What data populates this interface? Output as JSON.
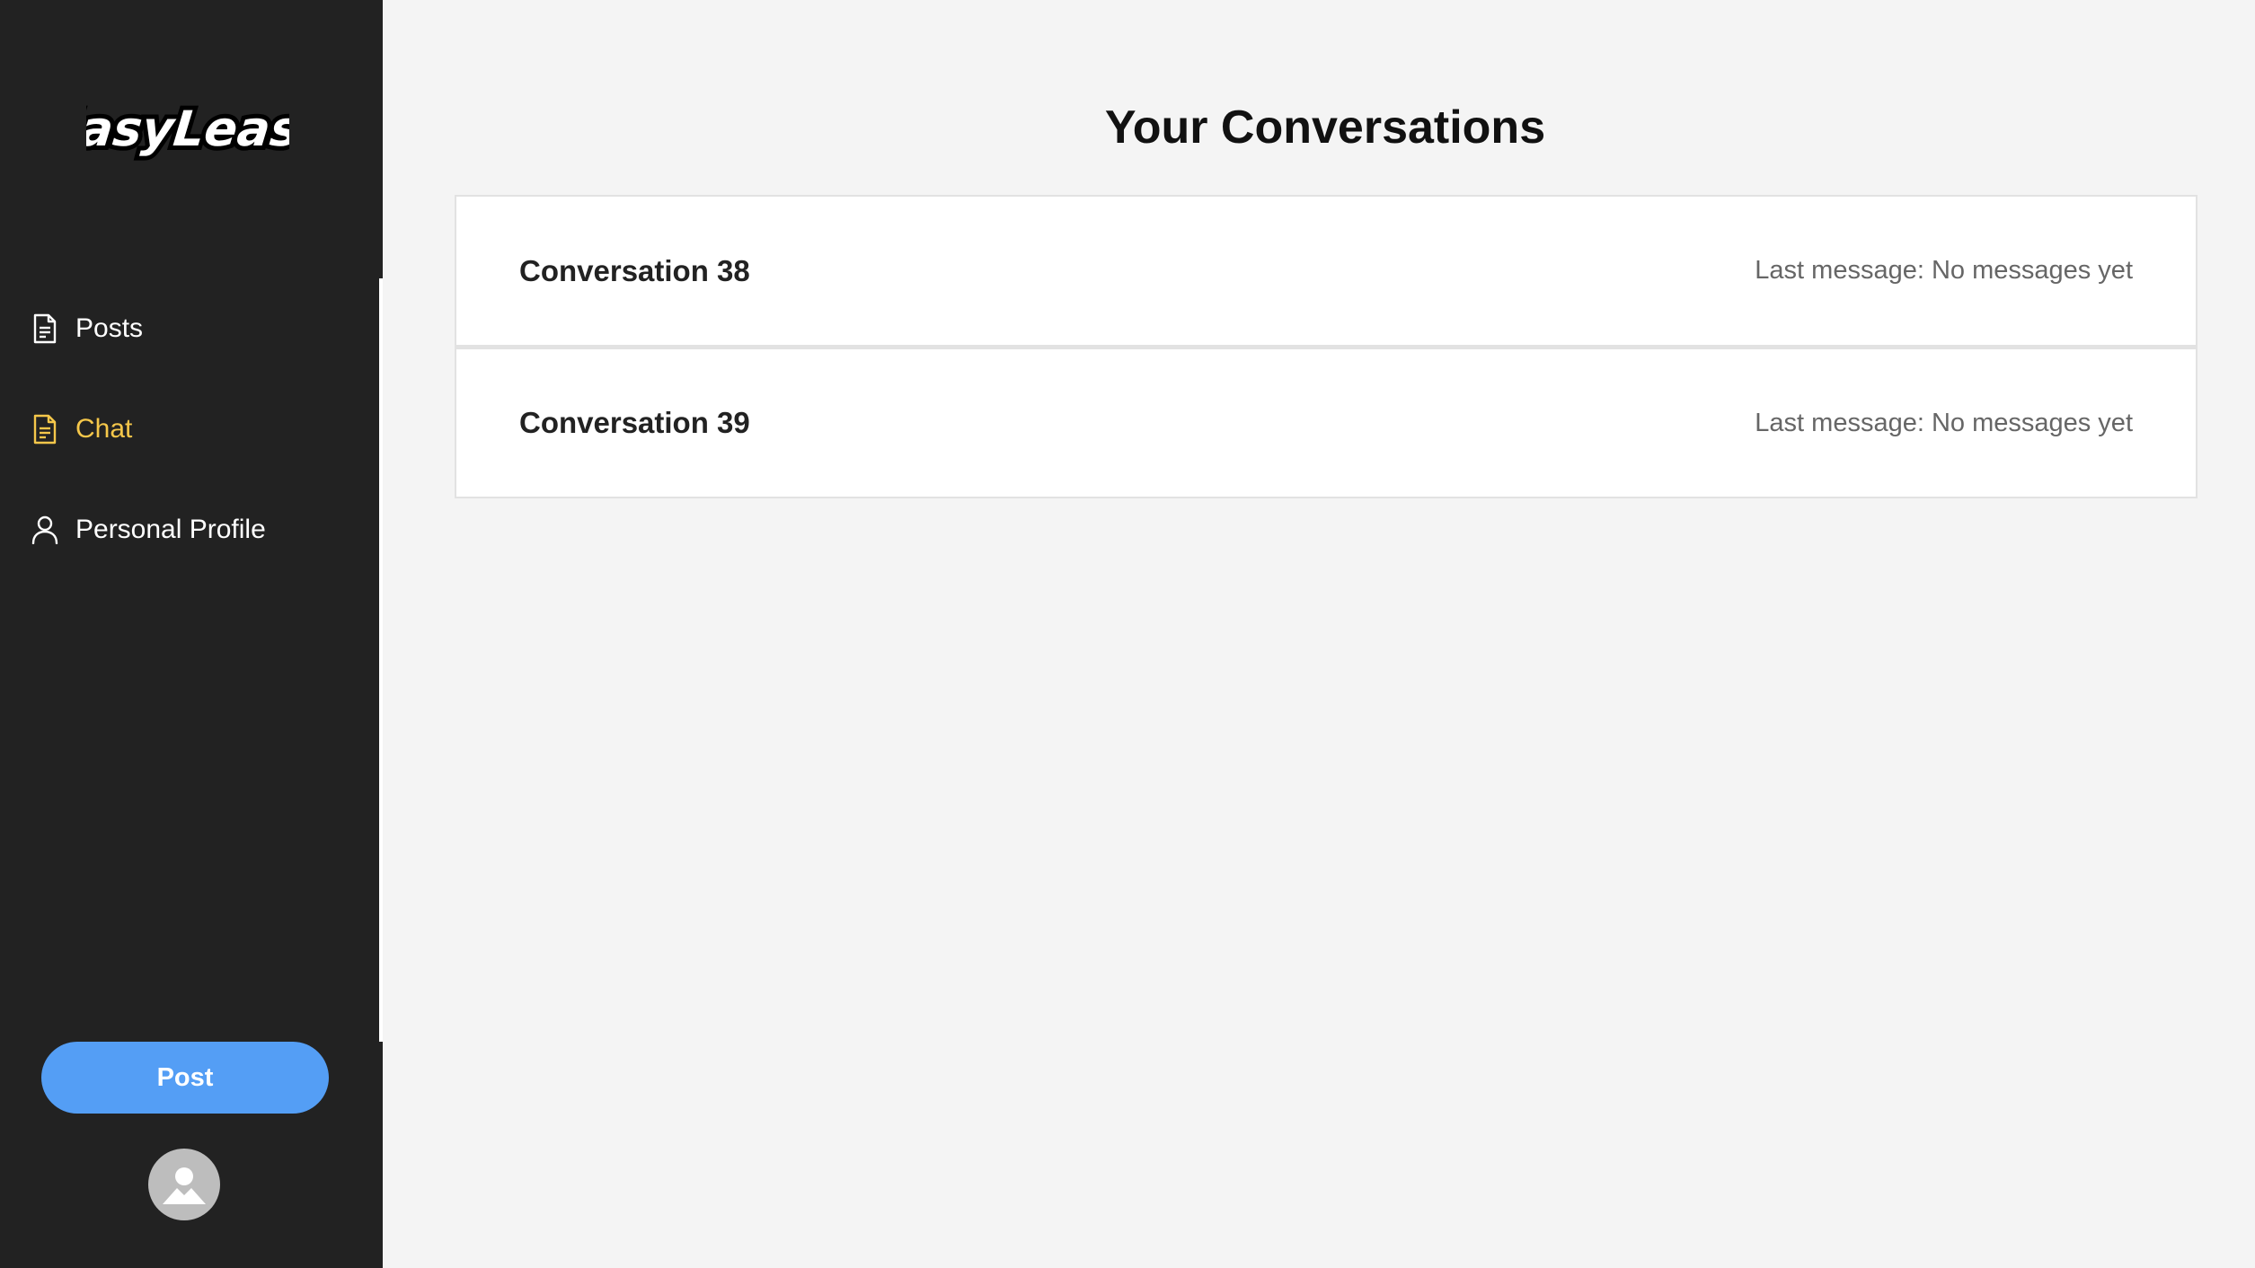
{
  "brand": {
    "logo_text": "EasyLeasy"
  },
  "sidebar": {
    "items": [
      {
        "label": "Posts",
        "icon": "document-icon",
        "active": false
      },
      {
        "label": "Chat",
        "icon": "document-icon",
        "active": true
      },
      {
        "label": "Personal Profile",
        "icon": "user-icon",
        "active": false
      }
    ],
    "post_button_label": "Post",
    "avatar_icon": "avatar-placeholder-icon"
  },
  "main": {
    "title": "Your Conversations",
    "conversations": [
      {
        "name": "Conversation 38",
        "last_message": "Last message: No messages yet"
      },
      {
        "name": "Conversation 39",
        "last_message": "Last message: No messages yet"
      }
    ]
  },
  "colors": {
    "sidebar_bg": "#222222",
    "active_nav": "#f5c74a",
    "post_button": "#549ef5",
    "page_bg": "#f4f4f4"
  }
}
